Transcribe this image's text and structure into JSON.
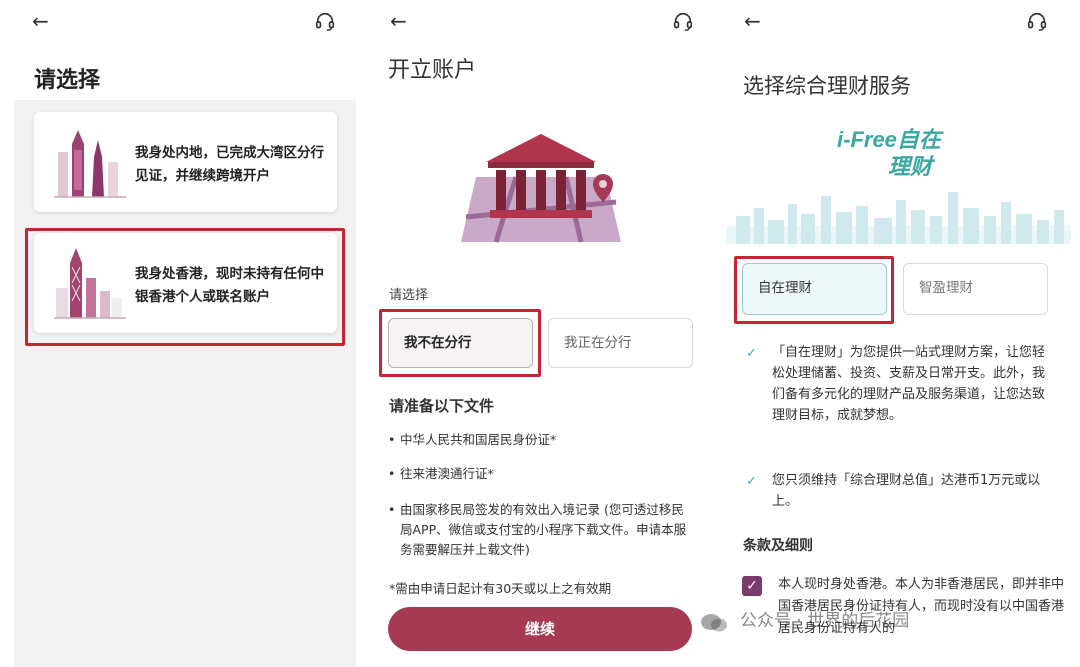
{
  "screen1": {
    "title": "请选择",
    "options": [
      {
        "label": "我身处内地，已完成大湾区分行见证，并继续跨境开户"
      },
      {
        "label": "我身处香港，现时未持有任何中银香港个人或联名账户"
      }
    ]
  },
  "screen2": {
    "title": "开立账户",
    "select_label": "请选择",
    "choices": [
      "我不在分行",
      "我正在分行"
    ],
    "documents_title": "请准备以下文件",
    "documents": [
      "中华人民共和国居民身份证*",
      "往来港澳通行证*",
      "由国家移民局签发的有效出入境记录 (您可透过移民局APP、微信或支付宝的小程序下载文件。申请本服务需要解压并上载文件)"
    ],
    "note": "*需由申请日起计有30天或以上之有效期",
    "continue_label": "继续"
  },
  "screen3": {
    "title": "选择综合理财服务",
    "logo_text_top": "i-Free自在",
    "logo_text_bottom": "理财",
    "choices": [
      "自在理财",
      "智盈理财"
    ],
    "features": [
      "「自在理财」为您提供一站式理财方案，让您轻松处理储蓄、投资、支薪及日常开支。此外，我们备有多元化的理财产品及服务渠道，让您达致理财目标，成就梦想。",
      "您只须维持「综合理财总值」达港币1万元或以上。"
    ],
    "terms_title": "条款及细则",
    "terms_text": "本人现时身处香港。本人为非香港居民，即并非中国香港居民身份证持有人，而现时没有以中国香港居民身份证持有人的"
  },
  "watermark": "公众号 · 世界的后花园",
  "colors": {
    "highlight": "#c62633",
    "brand": "#a63a52",
    "teal": "#4aa3b5"
  }
}
